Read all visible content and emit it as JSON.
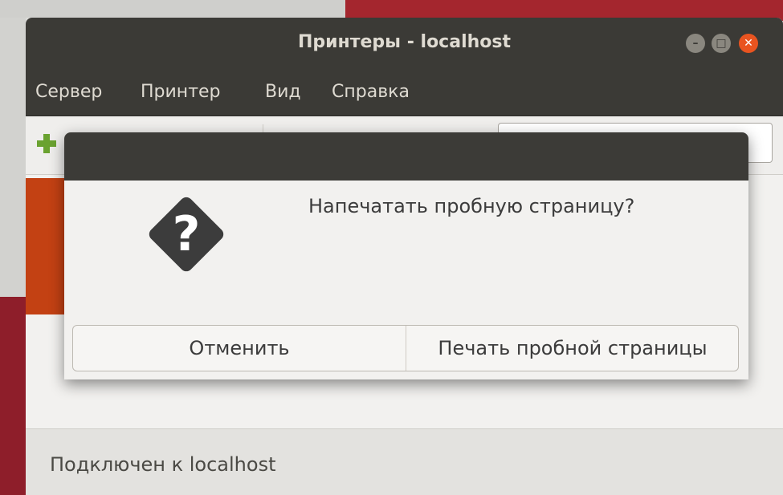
{
  "window": {
    "title": "Принтеры - localhost",
    "controls": [
      "minimize-icon",
      "maximize-icon",
      "close-icon"
    ]
  },
  "menubar": {
    "items": [
      "Сервер",
      "Принтер",
      "Вид",
      "Справка"
    ]
  },
  "statusbar": {
    "text": "Подключен к localhost"
  },
  "dialog": {
    "icon": "question-icon",
    "message": "Напечатать пробную страницу?",
    "cancel_label": "Отменить",
    "print_label": "Печать пробной страницы"
  },
  "colors": {
    "titlebar": "#3b3a36",
    "accent": "#e95420",
    "selected_printer": "#c34113",
    "add_icon": "#6aa230"
  }
}
